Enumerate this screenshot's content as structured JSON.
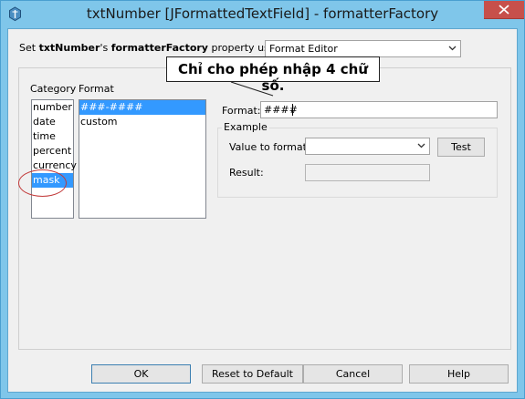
{
  "window": {
    "title": "txtNumber [JFormattedTextField] - formatterFactory",
    "icons": {
      "app": "java-cup-icon",
      "close": "close-icon"
    },
    "colors": {
      "titlebar": "#7fc6ea",
      "close_button": "#c7504b",
      "selection": "#3399ff",
      "annotation": "#c23a3a"
    }
  },
  "property_line": {
    "prefix": "Set ",
    "component": "txtNumber",
    "possessive": "'s ",
    "property": "formatterFactory",
    "suffix": " property using:"
  },
  "editor_select": {
    "value": "Format Editor",
    "icon": "chevron-down-icon"
  },
  "category": {
    "label": "Category",
    "items": [
      "number",
      "date",
      "time",
      "percent",
      "currency",
      "mask"
    ],
    "selected": "mask"
  },
  "format": {
    "label": "Format",
    "items": [
      "###-####",
      "custom"
    ],
    "selected": "###-####"
  },
  "format_field": {
    "label": "Format:",
    "value": "####"
  },
  "example": {
    "label": "Example",
    "value_label": "Value to format:",
    "value": "",
    "test_button": "Test",
    "result_label": "Result:",
    "result": ""
  },
  "annotation": {
    "text": "Chỉ cho phép nhập 4 chữ số."
  },
  "buttons": {
    "ok": "OK",
    "reset": "Reset to Default",
    "cancel": "Cancel",
    "help": "Help"
  }
}
